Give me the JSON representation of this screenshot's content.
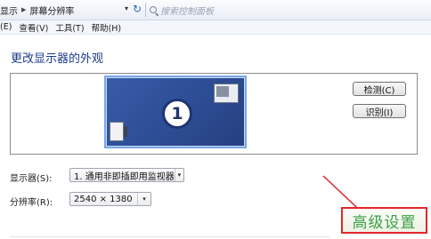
{
  "addressbar": {
    "crumbs": [
      "显示",
      "屏幕分辨率"
    ],
    "dropdown_glyph": "▾",
    "refresh_glyph": "↻",
    "search_placeholder": "搜索控制面板"
  },
  "menubar": {
    "items": [
      "(E)",
      "查看(V)",
      "工具(T)",
      "帮助(H)"
    ]
  },
  "page": {
    "heading": "更改显示器的外观"
  },
  "preview": {
    "monitor_number": "1",
    "detect_label": "检测(C)",
    "identify_label": "识别(I)"
  },
  "settings": {
    "display_label": "显示器(S):",
    "display_value": "1. 通用非即插即用监视器",
    "resolution_label": "分辨率(R):",
    "resolution_value": "2540 × 1380",
    "arrow_glyph": "▾"
  },
  "annotation": {
    "advanced_label": "高级设置",
    "highlight_color": "#e3262b",
    "text_color": "#3aa047"
  },
  "colors": {
    "monitor_fill": "#2e4f98",
    "monitor_border": "#7aa7e6",
    "heading": "#1b3a8a"
  }
}
